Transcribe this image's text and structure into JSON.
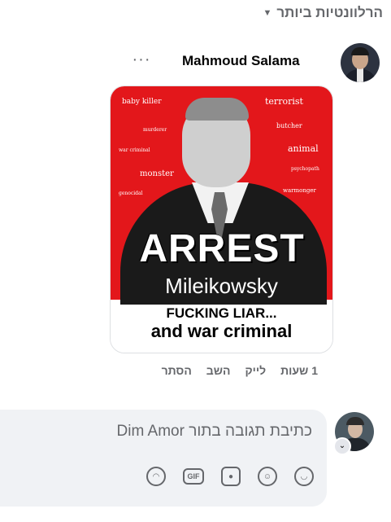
{
  "header": {
    "sort_label": "הרלוונטיות ביותר"
  },
  "comment": {
    "author": "Mahmoud Salama",
    "more_glyph": "···",
    "image_text": {
      "words": [
        "baby killer",
        "terrorist",
        "murderer",
        "butcher",
        "war criminal",
        "animal",
        "psychopath",
        "monster",
        "warmonger",
        "genocidal"
      ],
      "headline": "ARREST",
      "name": "Mileikowsky",
      "line1": "FUCKING LIAR...",
      "line2": "and war criminal"
    },
    "actions": {
      "time": "1 שעות",
      "like": "לייק",
      "reply": "השב",
      "hide": "הסתר"
    }
  },
  "reply": {
    "placeholder": "כתיבת תגובה בתור Dim Amor"
  },
  "icons": [
    "chevron-down-icon",
    "more-options-icon",
    "sticker-icon",
    "gif-icon",
    "camera-icon",
    "emoji-icon",
    "avatar-sticker-icon"
  ]
}
